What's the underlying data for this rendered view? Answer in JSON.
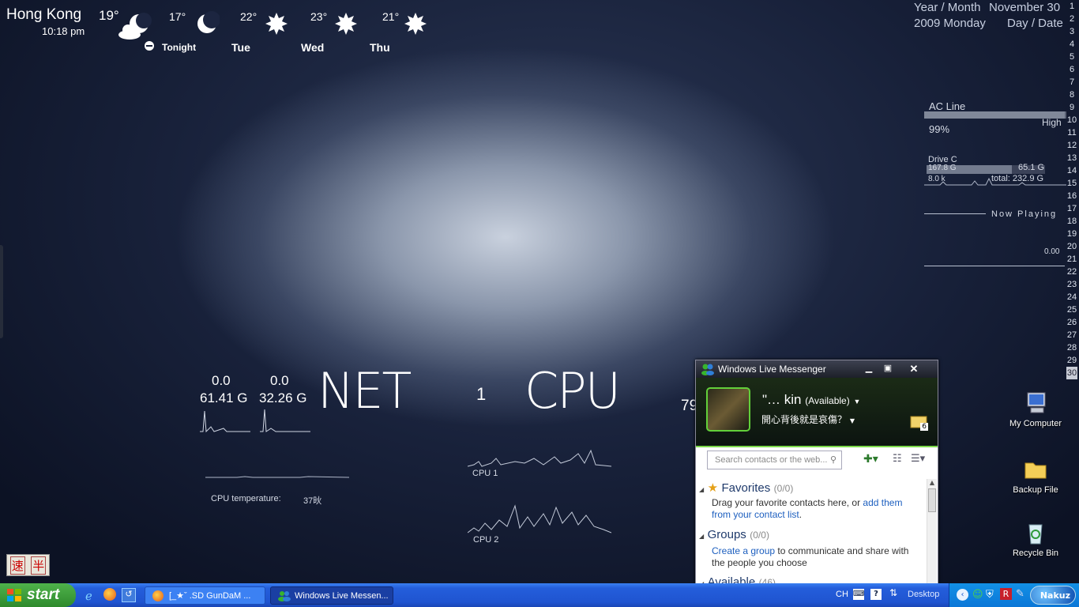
{
  "weather": {
    "city": "Hong Kong",
    "time": "10:18 pm",
    "current_temp": "19°",
    "forecast": [
      {
        "temp": "17°",
        "day": "Tonight",
        "icon": "moon-icon"
      },
      {
        "temp": "22°",
        "day": "Tue",
        "icon": "sun-icon"
      },
      {
        "temp": "23°",
        "day": "Wed",
        "icon": "sun-icon"
      },
      {
        "temp": "21°",
        "day": "Thu",
        "icon": "sun-icon"
      }
    ]
  },
  "calendar": {
    "line1_left": "Year / Month",
    "line1_right": "November 30",
    "line2_left": "2009 Monday",
    "line2_right": "Day / Date",
    "days": [
      "1",
      "2",
      "3",
      "4",
      "5",
      "6",
      "7",
      "8",
      "9",
      "10",
      "11",
      "12",
      "13",
      "14",
      "15",
      "16",
      "17",
      "18",
      "19",
      "20",
      "21",
      "22",
      "23",
      "24",
      "25",
      "26",
      "27",
      "28",
      "29",
      "30"
    ],
    "current_day": "30"
  },
  "power": {
    "label": "AC Line",
    "level": "High",
    "percent": "99%",
    "fill": 0.99
  },
  "drive": {
    "label": "Drive C",
    "used": "167.8 G",
    "free": "65.1 G",
    "rate": "8.0 k",
    "total": "total: 232.9 G",
    "fill": 0.72
  },
  "media": {
    "label": "Now Playing",
    "value": "0.00"
  },
  "net": {
    "title": "NET",
    "down_rate": "0.0",
    "up_rate": "0.0",
    "down_total": "61.41 G",
    "up_total": "32.26 G"
  },
  "cpu": {
    "title": "CPU",
    "value": "1",
    "partial_value": "79",
    "graph1_label": "CPU 1",
    "graph2_label": "CPU 2",
    "temp_label": "CPU temperature:",
    "temp_value": "37炚"
  },
  "ime": {
    "char1": "速",
    "char2": "半"
  },
  "desktop_icons": [
    {
      "label": "My Computer",
      "icon": "my-computer-icon"
    },
    {
      "label": "Backup File",
      "icon": "folder-icon"
    },
    {
      "label": "Recycle Bin",
      "icon": "recycle-bin-icon"
    }
  ],
  "messenger": {
    "title": "Windows Live Messenger",
    "display_name": "\"...   kin\u0000",
    "display_name_text": "\"…   kin",
    "status": "(Available)",
    "personal_message": "開心背後就是哀傷？",
    "inbox_count": "6",
    "search_placeholder": "Search contacts or the web...",
    "favorites_title": "Favorites",
    "favorites_count": "(0/0)",
    "favorites_text": "Drag your favorite contacts here, or ",
    "favorites_link": "add them from your contact list",
    "favorites_end": ".",
    "groups_title": "Groups",
    "groups_count": "(0/0)",
    "groups_link": "Create a group",
    "groups_text": " to communicate and share with the people you choose",
    "available_title": "Available",
    "available_count": "(46)"
  },
  "taskbar": {
    "start_label": "start",
    "task1": "[_★ˇ .SD GunDaM ...",
    "task2": "Windows Live Messen...",
    "lang": "CH",
    "desktop_label": "Desktop",
    "nakuz_label": "Nakuz"
  },
  "colors": {
    "taskbar": "#245edb",
    "start": "#3a9a37",
    "messenger_accent": "#7cd84a",
    "link": "#1d5fbf"
  }
}
